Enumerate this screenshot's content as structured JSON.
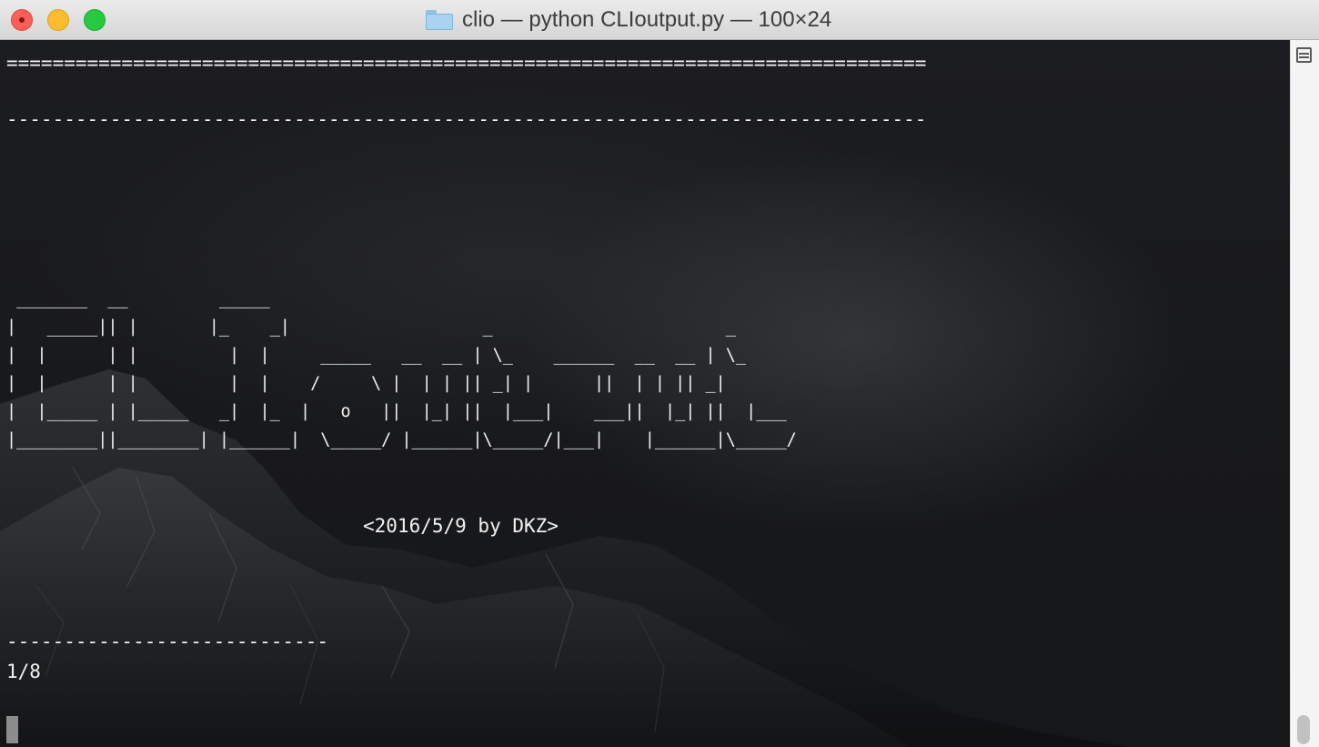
{
  "window": {
    "title": "clio — python CLIoutput.py — 100×24"
  },
  "terminal": {
    "rule_double": "================================================================================",
    "rule_single": "--------------------------------------------------------------------------------",
    "banner": " _______  __         _____\n|   _____|| |       |_    _|                   _                       _\n|  |      | |         |  |     _____   __  __ | \\_    ______  __  __ | \\_\n|  |      | |         |  |    /     \\ |  | | || _| |      ||  | | || _|\n|  |_____ | |_____   _|  |_  |   o   ||  |_| ||  |___|    ___||  |_| ||  |___\n|________||________| |______|  \\_____/ |______|\\_____/|___|    |______|\\_____/",
    "credit": "<2016/5/9 by DKZ>",
    "rule_short": "----------------------------",
    "page_indicator": "1/8"
  }
}
